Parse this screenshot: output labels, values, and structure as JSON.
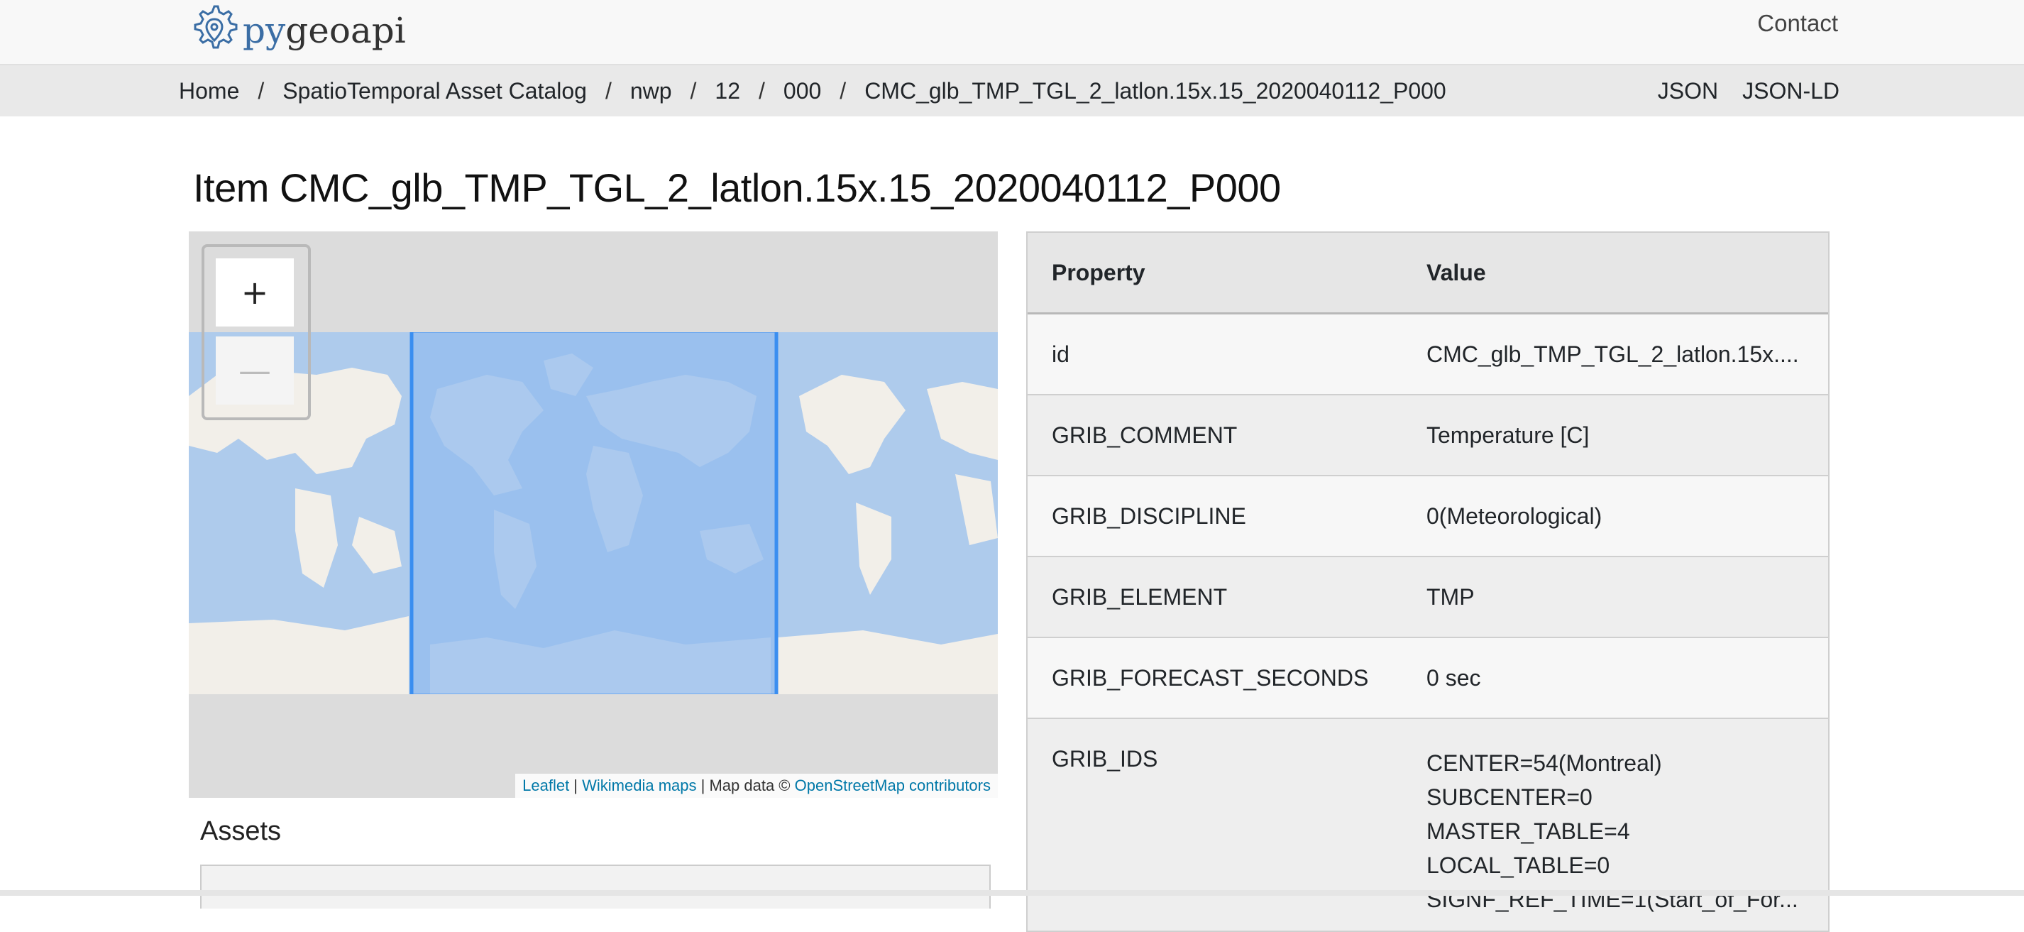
{
  "header": {
    "logo_text_py": "py",
    "logo_text_rest": "geoapi",
    "contact": "Contact"
  },
  "breadcrumb": {
    "items": [
      "Home",
      "SpatioTemporal Asset Catalog",
      "nwp",
      "12",
      "000",
      "CMC_glb_TMP_TGL_2_latlon.15x.15_2020040112_P000"
    ],
    "separator": "/"
  },
  "formats": [
    "JSON",
    "JSON-LD"
  ],
  "page_title": "Item CMC_glb_TMP_TGL_2_latlon.15x.15_2020040112_P000",
  "map": {
    "zoom_in": "+",
    "zoom_out": "—",
    "attribution": {
      "leaflet": "Leaflet",
      "sep1": " | ",
      "wikimedia": "Wikimedia maps",
      "mapdata": " | Map data © ",
      "osm": "OpenStreetMap contributors"
    },
    "colors": {
      "water": "#aecbec",
      "land": "#f2efe9",
      "bbox_fill": "#93bcef",
      "bbox_stroke": "#3a8ef0",
      "outside": "#dcdcdc"
    }
  },
  "assets": {
    "heading": "Assets"
  },
  "properties": {
    "header": {
      "property": "Property",
      "value": "Value"
    },
    "rows": [
      {
        "key": "id",
        "value": "CMC_glb_TMP_TGL_2_latlon.15x...."
      },
      {
        "key": "GRIB_COMMENT",
        "value": "Temperature [C]"
      },
      {
        "key": "GRIB_DISCIPLINE",
        "value": "0(Meteorological)"
      },
      {
        "key": "GRIB_ELEMENT",
        "value": "TMP"
      },
      {
        "key": "GRIB_FORECAST_SECONDS",
        "value": "0 sec"
      }
    ],
    "grib_ids": {
      "key": "GRIB_IDS",
      "lines": [
        "CENTER=54(Montreal)",
        "SUBCENTER=0",
        "MASTER_TABLE=4",
        "LOCAL_TABLE=0",
        "SIGNF_REF_TIME=1(Start_of_For..."
      ]
    }
  }
}
